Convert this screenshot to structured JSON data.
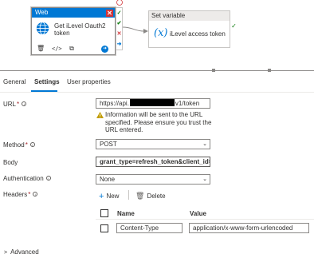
{
  "web_activity": {
    "header": "Web",
    "name": "Get iLevel Oauth2 token"
  },
  "set_variable": {
    "header": "Set variable",
    "name": "iLevel access token"
  },
  "tabs": {
    "general": "General",
    "settings": "Settings",
    "user_properties": "User properties"
  },
  "form": {
    "url_label": "URL",
    "url_prefix": "https://api.",
    "url_suffix": "v1/token",
    "warning": "Information will be sent to the URL specified. Please ensure you trust the URL entered.",
    "method_label": "Method",
    "method_value": "POST",
    "body_label": "Body",
    "body_value": "grant_type=refresh_token&client_id=...",
    "auth_label": "Authentication",
    "auth_value": "None",
    "headers_label": "Headers"
  },
  "headers": {
    "new_label": "New",
    "delete_label": "Delete",
    "col_name": "Name",
    "col_value": "Value",
    "rows": [
      {
        "name": "Content-Type",
        "value": "application/x-www-form-urlencoded"
      }
    ]
  },
  "advanced_label": "Advanced",
  "colors": {
    "accent": "#0078d4",
    "error": "#d13438",
    "success": "#107c10",
    "warning": "#c19c00"
  }
}
